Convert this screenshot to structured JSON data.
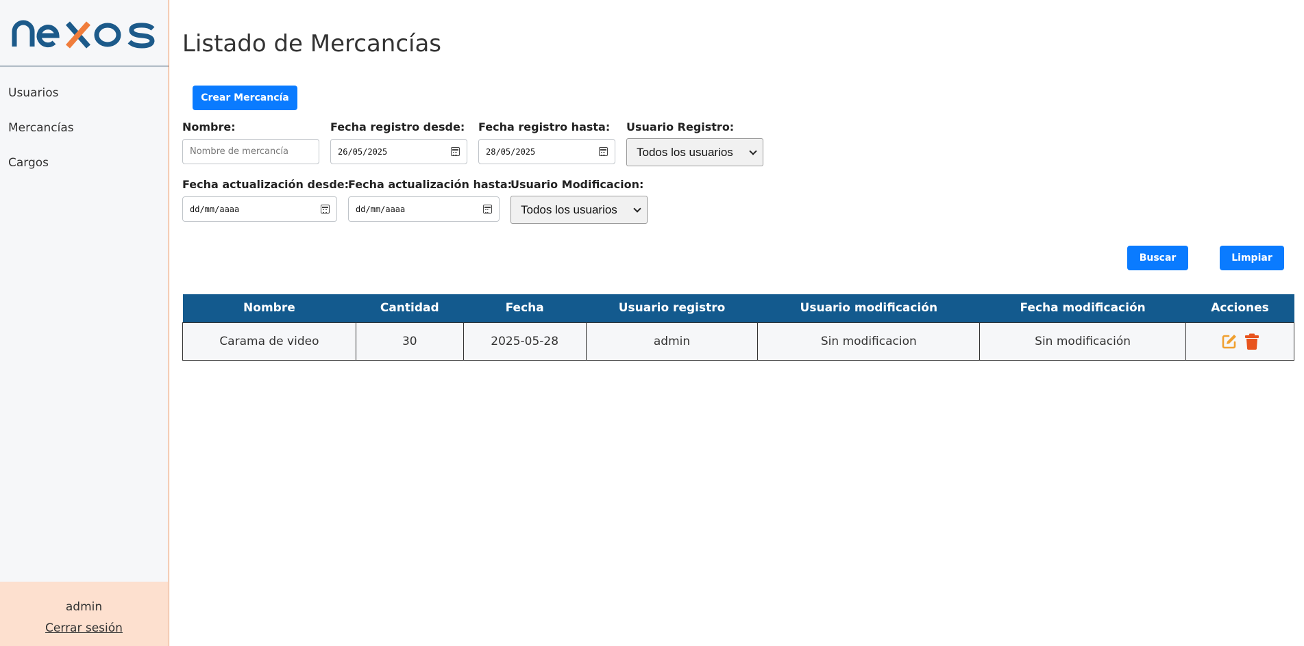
{
  "brand": {
    "logo_text": "nexos",
    "primary_color": "#1c5a8a",
    "accent_color": "#f07d3c"
  },
  "sidebar": {
    "items": [
      {
        "label": "Usuarios"
      },
      {
        "label": "Mercancías"
      },
      {
        "label": "Cargos"
      }
    ],
    "user": "admin",
    "logout_label": "Cerrar sesión"
  },
  "page": {
    "title": "Listado de Mercancías"
  },
  "toolbar": {
    "create_label": "Crear Mercancía",
    "search_label": "Buscar",
    "clear_label": "Limpiar"
  },
  "filters": {
    "name": {
      "label": "Nombre:",
      "placeholder": "Nombre de mercancía",
      "value": ""
    },
    "reg_from": {
      "label": "Fecha registro desde:",
      "value": "26/05/2025"
    },
    "reg_to": {
      "label": "Fecha registro hasta:",
      "value": "28/05/2025"
    },
    "reg_user": {
      "label": "Usuario Registro:",
      "value": "Todos los usuarios"
    },
    "upd_from": {
      "label": "Fecha actualización desde:",
      "value": "dd/mm/aaaa"
    },
    "upd_to": {
      "label": "Fecha actualización hasta:",
      "value": "dd/mm/aaaa"
    },
    "upd_user": {
      "label": "Usuario Modificacion:",
      "value": "Todos los usuarios"
    }
  },
  "table": {
    "columns": [
      "Nombre",
      "Cantidad",
      "Fecha",
      "Usuario registro",
      "Usuario modificación",
      "Fecha modificación",
      "Acciones"
    ],
    "rows": [
      {
        "nombre": "Carama de video",
        "cantidad": "30",
        "fecha": "2025-05-28",
        "usuario_registro": "admin",
        "usuario_modificacion": "Sin modificacion",
        "fecha_modificacion": "Sin modificación",
        "actions": [
          "edit-icon",
          "trash-icon"
        ]
      }
    ],
    "edit_color": "#f0a030",
    "delete_color": "#e8541e"
  }
}
